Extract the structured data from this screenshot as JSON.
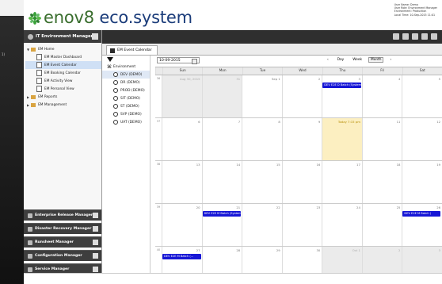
{
  "app": {
    "brand_part1": "enov",
    "brand_part2": "8",
    "brand_part3": " eco.system"
  },
  "user_info": {
    "line1": "User Name: Demo",
    "line2": "User Role: Environment Manager",
    "line3": "Environment: Production",
    "line4": "Local Time: 10-Sep-2015 11:01"
  },
  "sidebar": {
    "header": "IT Environment Manager",
    "tree": [
      {
        "label": "EM Home",
        "level": 1,
        "kind": "folder",
        "expanded": true
      },
      {
        "label": "EM Master Dashboard",
        "level": 2,
        "kind": "page"
      },
      {
        "label": "EM Event Calendar",
        "level": 2,
        "kind": "page",
        "selected": true
      },
      {
        "label": "EM Booking Calendar",
        "level": 2,
        "kind": "page"
      },
      {
        "label": "EM Activity View",
        "level": 2,
        "kind": "page"
      },
      {
        "label": "EM Personal View",
        "level": 2,
        "kind": "page"
      },
      {
        "label": "EM Reports",
        "level": 1,
        "kind": "folder",
        "expanded": false
      },
      {
        "label": "EM Management",
        "level": 1,
        "kind": "folder",
        "expanded": false
      }
    ],
    "accordion": [
      "Enterprise Release Manager",
      "Disaster Recovery Manager",
      "Runsheet Manager",
      "Configuration Manager",
      "Service Manager"
    ]
  },
  "tab": {
    "label": "EM Event Calendar"
  },
  "environments": {
    "root": "Environment",
    "items": [
      "DEV (DEMO)",
      "DR (DEMO)",
      "PROD (DEMO)",
      "SIT (DEMO)",
      "ST (DEMO)",
      "SVP (DEMO)",
      "UAT (DEMO)"
    ]
  },
  "calendar": {
    "date": "10-09-2015",
    "nav": {
      "prev": "‹",
      "day": "Day",
      "week": "Week",
      "month": "Month",
      "next": "›"
    },
    "day_names": [
      "Sun",
      "Mon",
      "Tue",
      "Wed",
      "Thu",
      "Fri",
      "Sat"
    ],
    "weeks": [
      {
        "num": "36",
        "days": [
          "Aug 30, 2015",
          "31",
          "Sep 1",
          "2",
          "3",
          "4",
          "5"
        ],
        "other": [
          0,
          1
        ]
      },
      {
        "num": "37",
        "days": [
          "6",
          "7",
          "8",
          "9",
          "Today 7:15 pm",
          "11",
          "12"
        ],
        "today": 4
      },
      {
        "num": "38",
        "days": [
          "13",
          "14",
          "15",
          "16",
          "17",
          "18",
          "19"
        ]
      },
      {
        "num": "39",
        "days": [
          "20",
          "21",
          "22",
          "23",
          "24",
          "25",
          "26"
        ]
      },
      {
        "num": "40",
        "days": [
          "27",
          "28",
          "29",
          "30",
          "Oct 1",
          "2",
          "3"
        ],
        "other": [
          4,
          5,
          6
        ]
      }
    ],
    "events": [
      {
        "label": "DEV E2E D Batch (System Date: 03-09-20...",
        "week": 0,
        "day": 4
      },
      {
        "label": "DEV E2E M Batch (System Date: 23-09-20...",
        "week": 3,
        "day": 1
      },
      {
        "label": "DEV E2E M Batch (",
        "week": 3,
        "day": 6
      },
      {
        "label": "DEV E2E M Batch (...",
        "week": 4,
        "day": 0
      }
    ]
  }
}
